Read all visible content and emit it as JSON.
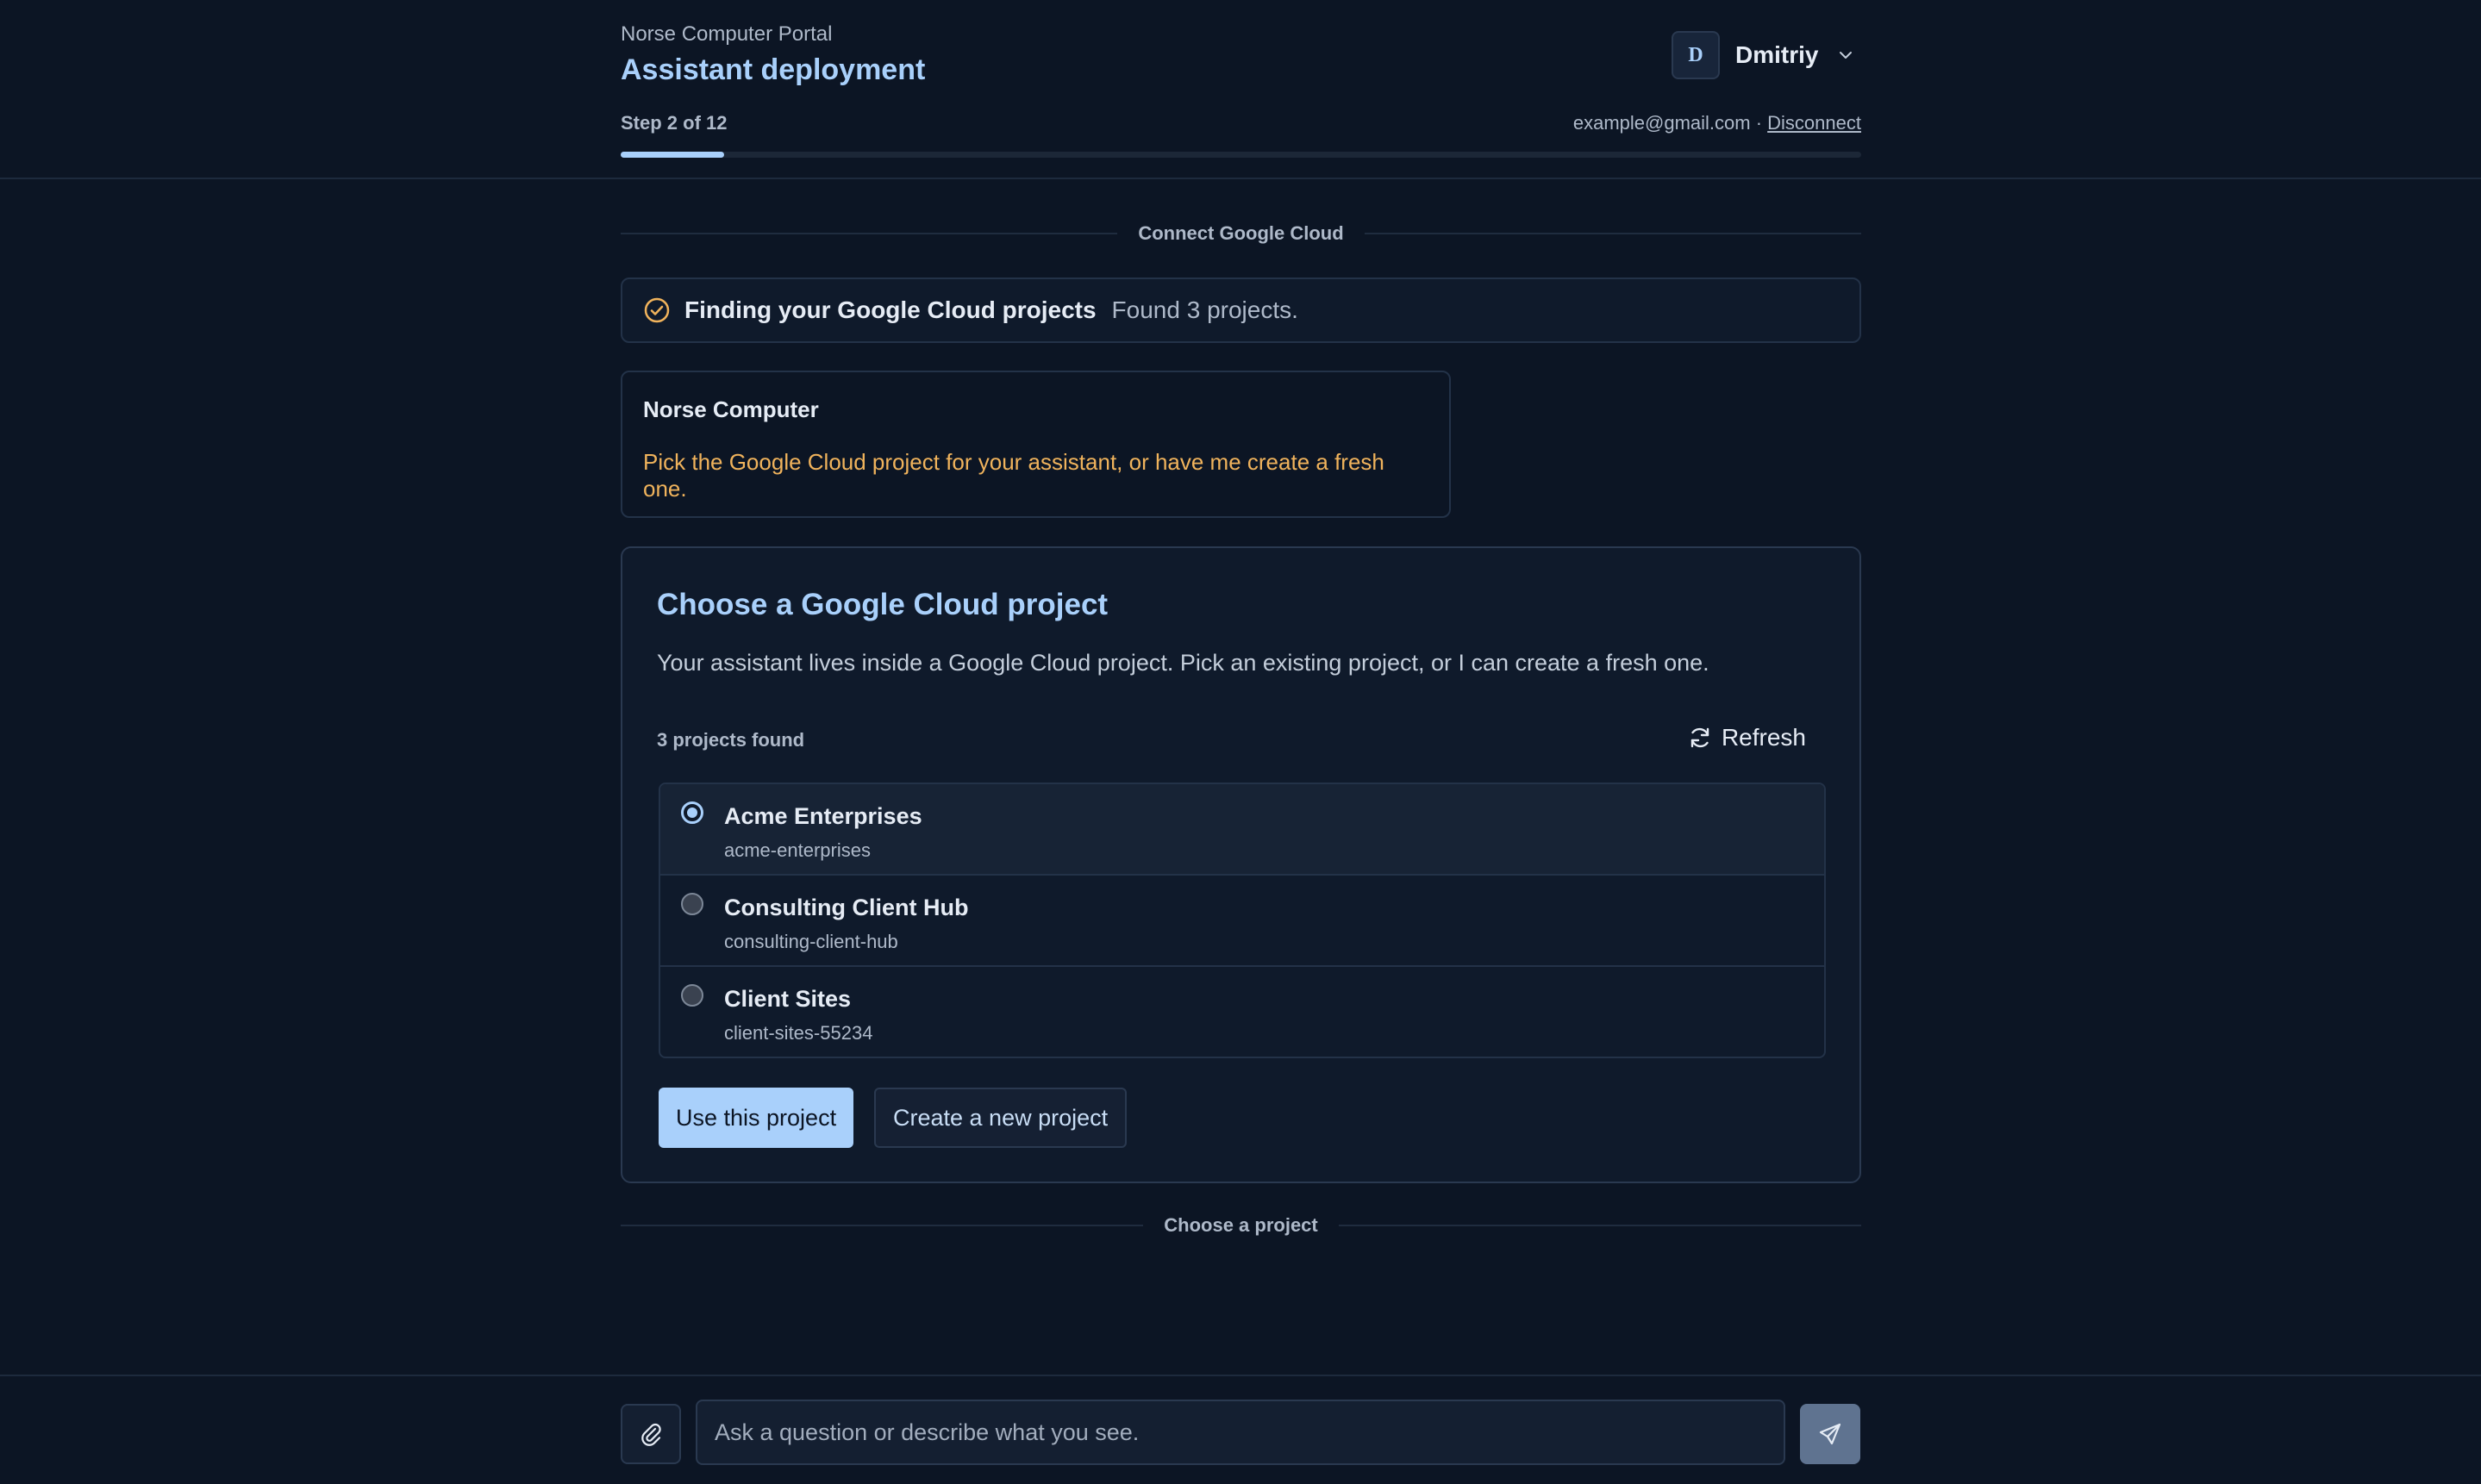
{
  "header": {
    "portal_name": "Norse Computer Portal",
    "title": "Assistant deployment",
    "step_text": "Step 2 of 12",
    "progress_fraction": 0.0833,
    "user": {
      "initial": "D",
      "name": "Dmitriy"
    },
    "email": "example@gmail.com",
    "separator": "·",
    "disconnect_label": "Disconnect"
  },
  "section_divider_top": "Connect Google Cloud",
  "status": {
    "icon": "check-circle-icon",
    "title": "Finding your Google Cloud projects",
    "detail": "Found 3 projects."
  },
  "message": {
    "sender": "Norse Computer",
    "text": "Pick the Google Cloud project for your assistant, or have me create a fresh one."
  },
  "panel": {
    "title": "Choose a Google Cloud project",
    "description": "Your assistant lives inside a Google Cloud project. Pick an existing project, or I can create a fresh one.",
    "found_count": "3 projects found",
    "refresh_label": "Refresh",
    "projects": [
      {
        "name": "Acme Enterprises",
        "id": "acme-enterprises",
        "selected": true
      },
      {
        "name": "Consulting Client Hub",
        "id": "consulting-client-hub",
        "selected": false
      },
      {
        "name": "Client Sites",
        "id": "client-sites-55234",
        "selected": false
      }
    ],
    "use_button": "Use this project",
    "create_button": "Create a new project"
  },
  "section_divider_bottom": "Choose a project",
  "composer": {
    "placeholder": "Ask a question or describe what you see."
  },
  "colors": {
    "background": "#0c1524",
    "accent": "#a9d0fb",
    "warning_text": "#f0b35c",
    "check_icon": "#f0b35c"
  }
}
